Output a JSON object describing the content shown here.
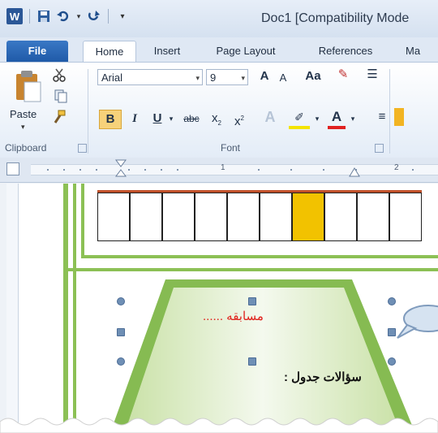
{
  "titlebar": {
    "app_icon_letter": "W",
    "title": "Doc1 [Compatibility Mode"
  },
  "tabs": [
    {
      "label": "File"
    },
    {
      "label": "Home"
    },
    {
      "label": "Insert"
    },
    {
      "label": "Page Layout"
    },
    {
      "label": "References"
    },
    {
      "label": "Ma"
    }
  ],
  "ribbon": {
    "clipboard": {
      "paste_label": "Paste",
      "group_label": "Clipboard"
    },
    "font": {
      "font_name": "Arial",
      "font_size": "9",
      "grow_font": "A",
      "shrink_font": "A",
      "change_case": "Aa",
      "bold": "B",
      "italic": "I",
      "underline": "U",
      "strikethrough": "abc",
      "subscript": "x",
      "superscript": "x",
      "text_effects": "A",
      "font_color": "A",
      "group_label": "Font"
    }
  },
  "ruler": {
    "numbers": [
      "1",
      "2"
    ]
  },
  "document": {
    "table_cells": 10,
    "highlighted_cell": 7,
    "highlight_color": "#f2c200",
    "heading_ar": "مسابقه ......",
    "question_ar": "سؤالات جدول :"
  },
  "colors": {
    "accent": "#2b5797",
    "table_top_border": "#c0502a",
    "frame_green": "#8cc055"
  }
}
